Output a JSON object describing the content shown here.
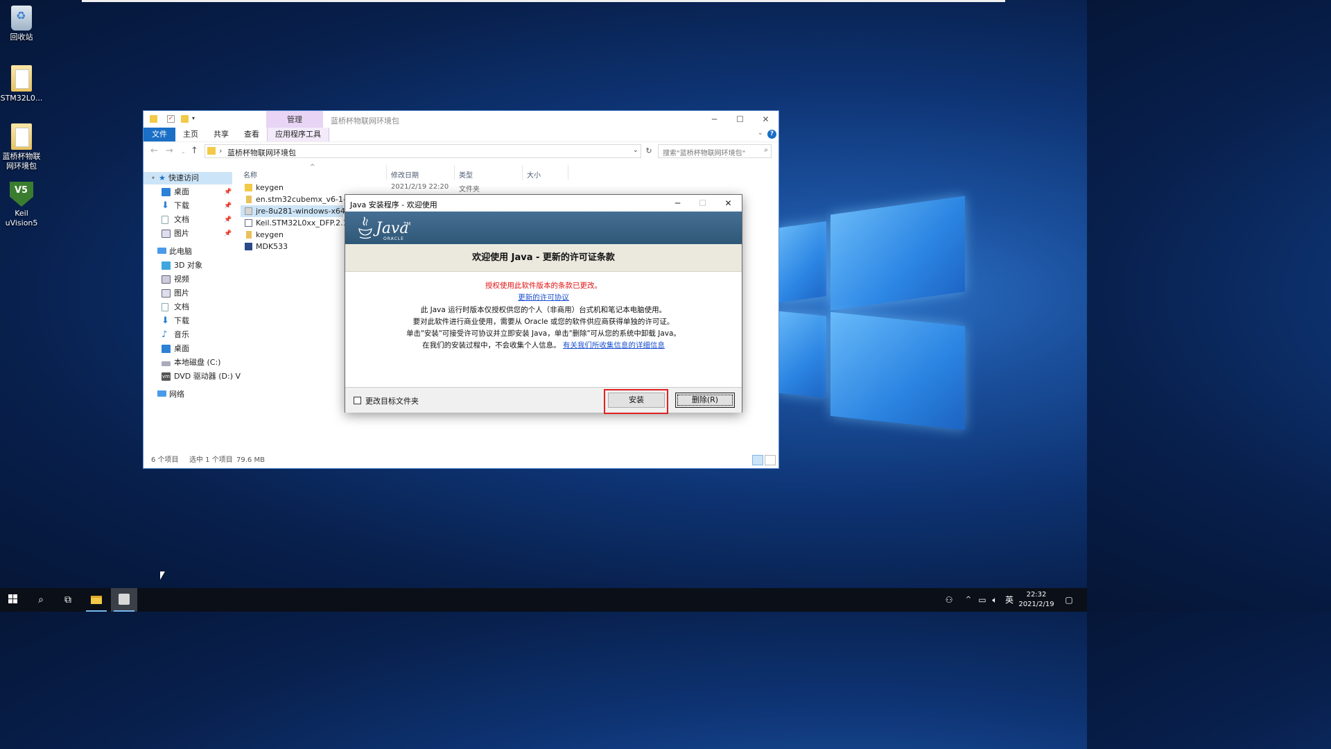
{
  "desktop": {
    "icons": [
      {
        "label": "回收站"
      },
      {
        "label": "STM32L0..."
      },
      {
        "label": "蓝桥杯物联网环境包"
      },
      {
        "label": "Keil uVision5"
      }
    ]
  },
  "explorer": {
    "title": "蓝桥杯物联网环境包",
    "manage_tab": "管理",
    "ribbon_tabs": [
      "文件",
      "主页",
      "共享",
      "查看",
      "应用程序工具"
    ],
    "address_path": "蓝桥杯物联网环境包",
    "search_placeholder": "搜索\"蓝桥杯物联网环境包\"",
    "nav": [
      {
        "label": "快速访问",
        "icon": "star-icon"
      },
      {
        "label": "桌面",
        "icon": "desktop-icon"
      },
      {
        "label": "下载",
        "icon": "download-icon"
      },
      {
        "label": "文档",
        "icon": "document-icon"
      },
      {
        "label": "图片",
        "icon": "picture-icon"
      },
      {
        "label": "此电脑",
        "icon": "computer-icon"
      },
      {
        "label": "3D 对象",
        "icon": "cube-icon"
      },
      {
        "label": "视频",
        "icon": "video-icon"
      },
      {
        "label": "图片",
        "icon": "picture-icon"
      },
      {
        "label": "文档",
        "icon": "document-icon"
      },
      {
        "label": "下载",
        "icon": "download-icon"
      },
      {
        "label": "音乐",
        "icon": "music-icon"
      },
      {
        "label": "桌面",
        "icon": "desktop-icon"
      },
      {
        "label": "本地磁盘 (C:)",
        "icon": "drive-icon"
      },
      {
        "label": "DVD 驱动器 (D:) V",
        "icon": "dvd-icon"
      },
      {
        "label": "网络",
        "icon": "network-icon"
      }
    ],
    "columns": [
      "名称",
      "修改日期",
      "类型",
      "大小"
    ],
    "files": [
      {
        "name": "keygen",
        "date": "2021/2/19 22:20",
        "type": "文件夹"
      },
      {
        "name": "en.stm32cubemx_v6-1-1"
      },
      {
        "name": "jre-8u281-windows-x64"
      },
      {
        "name": "Keil.STM32L0xx_DFP.2.1.0"
      },
      {
        "name": "keygen"
      },
      {
        "name": "MDK533"
      }
    ],
    "status": {
      "count": "6 个项目",
      "selected": "选中 1 个项目",
      "size": "79.6 MB"
    }
  },
  "dialog": {
    "title": "Java 安装程序 - 欢迎使用",
    "logo_text": "Java",
    "logo_tm": "TM",
    "logo_sub": "ORACLE",
    "heading": "欢迎使用 Java - 更新的许可证条款",
    "red_notice": "授权使用此软件版本的条款已更改。",
    "license_link": "更新的许可协议",
    "line1": "此 Java 运行时版本仅授权供您的个人（非商用）台式机和笔记本电脑使用。",
    "line2": "要对此软件进行商业使用，需要从 Oracle 或您的软件供应商获得单独的许可证。",
    "line3": "单击\"安装\"可接受许可协议并立即安装 Java，单击\"删除\"可从您的系统中卸载 Java。",
    "line4_prefix": "在我们的安装过程中，不会收集个人信息。",
    "info_link": "有关我们所收集信息的详细信息",
    "checkbox_label": "更改目标文件夹",
    "install_button": "安装",
    "remove_button": "删除(R)"
  },
  "taskbar": {
    "ime": "英",
    "time": "22:32",
    "date": "2021/2/19"
  }
}
